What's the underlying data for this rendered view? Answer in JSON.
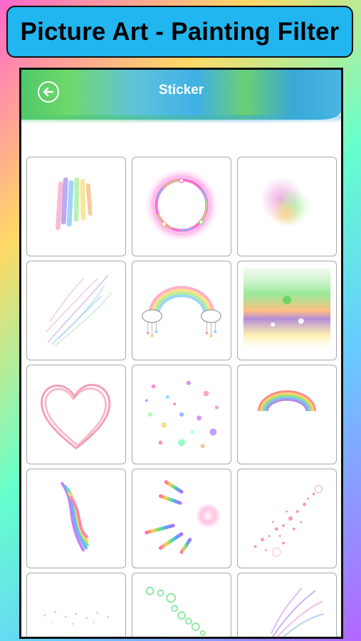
{
  "banner": {
    "title": "Picture Art - Painting Filter"
  },
  "header": {
    "title": "Sticker",
    "back_icon": "back-arrow-icon"
  },
  "stickers": [
    {
      "name": "rainbow-brush-strokes"
    },
    {
      "name": "glowing-rainbow-ring"
    },
    {
      "name": "rainbow-smoke-blob"
    },
    {
      "name": "pastel-feather-swirls"
    },
    {
      "name": "rainbow-with-clouds"
    },
    {
      "name": "rainbow-light-leak"
    },
    {
      "name": "pink-heart-outline"
    },
    {
      "name": "rainbow-splatter-hearts"
    },
    {
      "name": "small-rainbow-arc"
    },
    {
      "name": "rainbow-wave-stroke"
    },
    {
      "name": "rainbow-capsule-rays"
    },
    {
      "name": "pink-sparkle-trail"
    },
    {
      "name": "pink-sparkle-dust"
    },
    {
      "name": "green-bubble-trail"
    },
    {
      "name": "purple-sparkle-burst"
    }
  ]
}
